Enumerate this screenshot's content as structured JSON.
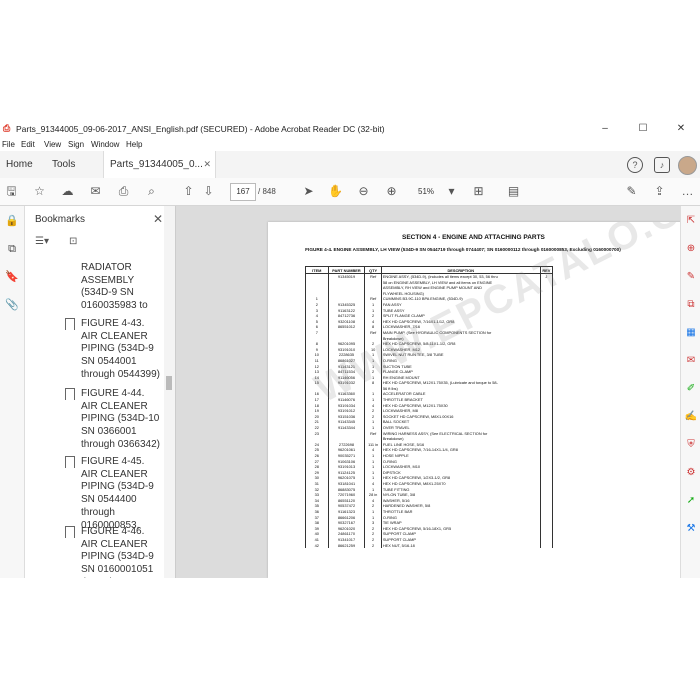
{
  "window": {
    "title": "Parts_91344005_09-06-2017_ANSI_English.pdf (SECURED) - Adobe Acrobat Reader DC (32-bit)",
    "minimize": "–",
    "maximize": "☐",
    "close": "✕"
  },
  "menu": [
    "File",
    "Edit",
    "View",
    "Sign",
    "Window",
    "Help"
  ],
  "tabs": {
    "home": "Home",
    "tools": "Tools",
    "document": "Parts_91344005_0...",
    "close": "✕"
  },
  "toolbar": {
    "page_current": "167",
    "page_total": "/  848",
    "zoom": "51%"
  },
  "bookmarks": {
    "title": "Bookmarks",
    "close": "✕",
    "items": [
      {
        "text": "RADIATOR ASSEMBLY (534D-9 SN 0160035983 to"
      },
      {
        "text": "FIGURE 4-43. AIR CLEANER PIPING (534D-9 SN 0544001 through 0544399)"
      },
      {
        "text": "FIGURE 4-44. AIR CLEANER PIPING (534D-10 SN 0366001 through 0366342)"
      },
      {
        "text": "FIGURE 4-45. AIR CLEANER PIPING (534D-9 SN 0544400 through 0160000853,"
      },
      {
        "text": "FIGURE 4-46. AIR CLEANER PIPING (534D-9 SN 0160001051 through"
      }
    ]
  },
  "document": {
    "section": "SECTION 4 - ENGINE AND ATTACHING PARTS",
    "figure": "FIGURE 4-4. ENGINE ASSEMBLY, LH VIEW (534D-9 SN 0544719 through 0744407; SN 0160000112 through 0160000853, Excluding 0160000700)",
    "headers": [
      "ITEM",
      "PART NUMBER",
      "QTY",
      "DESCRIPTION",
      "REV"
    ],
    "rows": [
      [
        "",
        "91345019",
        "Ref",
        "ENGINE ASSY, (534D-9), (includes all items except 30, 53, 56 thru",
        "J"
      ],
      [
        "",
        "",
        "",
        "58 on ENGINE ASSEMBLY, LH VIEW and all items on ENGINE",
        ""
      ],
      [
        "",
        "",
        "",
        "ASSEMBLY, RH VIEW and ENGINE PUMP MOUNT AND",
        ""
      ],
      [
        "",
        "",
        "",
        "FLYWHEEL HOUSING)",
        ""
      ],
      [
        "1",
        "",
        "Ref",
        "CUMMINS B3.9C-110 BPA ENGINE, (534D-9)",
        ""
      ],
      [
        "2",
        "91345325",
        "1",
        "FAN ASSY",
        ""
      ],
      [
        "3",
        "91163122",
        "1",
        "TUBE ASSY",
        ""
      ],
      [
        "4",
        "84712736",
        "2",
        "SPLIT FLANGE CLAMP",
        ""
      ],
      [
        "5",
        "93201108",
        "4",
        "HEX HD CAPSCREW, 7/16X1-1/12, GR8",
        ""
      ],
      [
        "6",
        "86551012",
        "8",
        "LOCKWASHER, 7/16",
        ""
      ],
      [
        "7",
        "",
        "Ref",
        "MAIN PUMP, (See HYDRAULIC COMPONENTS SECTION for",
        ""
      ],
      [
        "",
        "",
        "",
        "Breakdown)",
        ""
      ],
      [
        "8",
        "96201095",
        "2",
        "HEX HD CAPSCREW, 5/8-11X1-1/2, GR8",
        ""
      ],
      [
        "9",
        "93191010",
        "10",
        "LOCKWASHER, M12",
        ""
      ],
      [
        "10",
        "2228635",
        "1",
        "SWIVEL NUT RUN TEE, 3/8 TUBE",
        ""
      ],
      [
        "11",
        "86861027",
        "1",
        "O-RING",
        ""
      ],
      [
        "12",
        "91143121",
        "1",
        "SUCTION TUBE",
        ""
      ],
      [
        "13",
        "84711534",
        "2",
        "FLANGE CLAMP",
        ""
      ],
      [
        "14",
        "91146056",
        "1",
        "RH ENGINE MOUNT",
        ""
      ],
      [
        "15",
        "93191032",
        "8",
        "HEX HD CAPSCREW, M12X1.75X35, (Lubricate and torque to 58-",
        ""
      ],
      [
        "",
        "",
        "",
        "56 ft lbs)",
        ""
      ],
      [
        "16",
        "91163360",
        "1",
        "ACCELERATOR CABLE",
        ""
      ],
      [
        "17",
        "91146076",
        "1",
        "THROTTLE BRACKET",
        ""
      ],
      [
        "18",
        "93191034",
        "4",
        "HEX HD CAPSCREW, M12X1.75X30",
        ""
      ],
      [
        "19",
        "93191012",
        "2",
        "LOCKWASHER, M8",
        ""
      ],
      [
        "20",
        "93151036",
        "2",
        "SOCKET HD CAPSCREW, M8X1.00X16",
        ""
      ],
      [
        "21",
        "91143345",
        "1",
        "BALL SOCKET",
        ""
      ],
      [
        "22",
        "91143344",
        "1",
        "OVER TRAVEL",
        ""
      ],
      [
        "23",
        "",
        "Ref",
        "WIRING HARNESS ASSY, (See ELECTRICAL SECTION for",
        ""
      ],
      [
        "",
        "",
        "",
        "Breakdown)",
        ""
      ],
      [
        "24",
        "2722698",
        "111 in",
        "FUEL LINE HOSE, 5/16",
        ""
      ],
      [
        "25",
        "96201061",
        "4",
        "HEX HD CAPSCREW, 7/16-14X1-1/4, GR8",
        ""
      ],
      [
        "26",
        "90035271",
        "1",
        "HOSE NIPPLE",
        ""
      ],
      [
        "27",
        "91063106",
        "1",
        "O-RING",
        ""
      ],
      [
        "28",
        "93191013",
        "1",
        "LOCKWASHER, M10",
        ""
      ],
      [
        "29",
        "91124125",
        "1",
        "DIPSTICK",
        ""
      ],
      [
        "30",
        "96201075",
        "1",
        "HEX HD CAPSCREW, 1/2X3-1/2, GR8",
        ""
      ],
      [
        "31",
        "93181041",
        "4",
        "HEX HD CAPSCREW, M8X1.25X70",
        ""
      ],
      [
        "32",
        "86883075",
        "1",
        "TUBE FITTING",
        ""
      ],
      [
        "33",
        "72071960",
        "28 in",
        "NYLON TUBE, 3/8",
        ""
      ],
      [
        "34",
        "86551120",
        "4",
        "WASHER, 5/16",
        ""
      ],
      [
        "35",
        "90537472",
        "2",
        "HARDENED WASHER, 5/8",
        ""
      ],
      [
        "36",
        "91161323",
        "1",
        "THROTTLE BAR",
        ""
      ],
      [
        "37",
        "86661206",
        "1",
        "O-RING",
        ""
      ],
      [
        "38",
        "90327167",
        "3",
        "TIE WRAP",
        ""
      ],
      [
        "39",
        "96201020",
        "2",
        "HEX HD CAPSCREW, 5/16-18X1, GR5",
        ""
      ],
      [
        "40",
        "24861170",
        "2",
        "SUPPORT CLAMP",
        ""
      ],
      [
        "41",
        "91341017",
        "2",
        "SUPPORT CLAMP",
        ""
      ],
      [
        "42",
        "86621259",
        "2",
        "HEX NUT, 5/16-18",
        ""
      ]
    ]
  }
}
